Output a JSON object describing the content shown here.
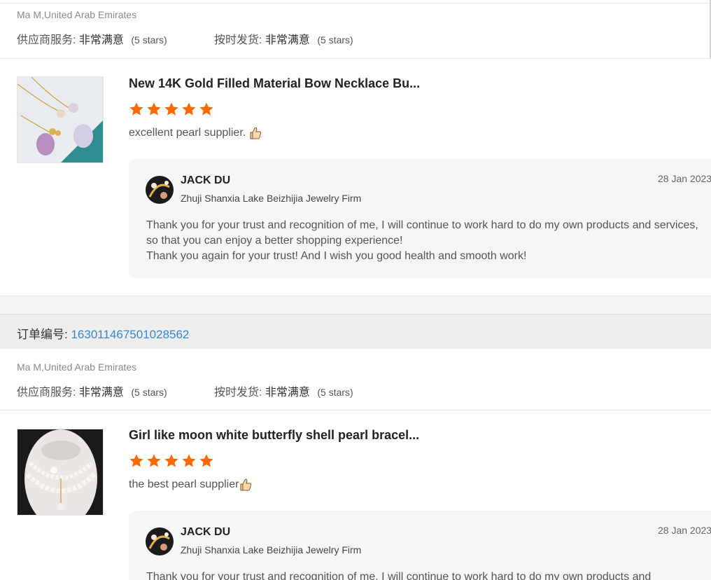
{
  "reviews": [
    {
      "buyer": "Ma M,United Arab Emirates",
      "supplier_service_label": "供应商服务:",
      "supplier_service_value": "非常满意",
      "supplier_service_stars": "(5 stars)",
      "shipping_label": "按时发货:",
      "shipping_value": "非常满意",
      "shipping_stars": "(5 stars)",
      "product": {
        "title": "New 14K Gold Filled Material Bow Necklace Bu...",
        "stars": 5,
        "comment": "excellent pearl supplier.",
        "comment_icon": "thumbs-up-icon"
      },
      "reply": {
        "name": "JACK DU",
        "company": "Zhuji Shanxia Lake Beizhijia Jewelry Firm",
        "date": "28 Jan 2023",
        "text_line1": "Thank you for your trust and recognition of me, I will continue to work hard to do my own products and services, so that you can enjoy a better shopping experience!",
        "text_line2": "Thank you again for your trust! And I wish you good health and smooth work!"
      }
    },
    {
      "order_label": "订单编号:",
      "order_number": "163011467501028562",
      "buyer": "Ma M,United Arab Emirates",
      "supplier_service_label": "供应商服务:",
      "supplier_service_value": "非常满意",
      "supplier_service_stars": "(5 stars)",
      "shipping_label": "按时发货:",
      "shipping_value": "非常满意",
      "shipping_stars": "(5 stars)",
      "product": {
        "title": "Girl like moon white butterfly shell pearl bracel...",
        "stars": 5,
        "comment": "the best pearl supplier",
        "comment_icon": "thumbs-up-icon"
      },
      "reply": {
        "name": "JACK DU",
        "company": "Zhuji Shanxia Lake Beizhijia Jewelry Firm",
        "date": "28 Jan 2023",
        "text_line1": "Thank you for your trust and recognition of me, I will continue to work hard to do my own products and"
      }
    }
  ],
  "colors": {
    "star": "#ff6a00",
    "link": "#3a87c8",
    "reply_bg": "#f5f6f8",
    "order_bar_bg": "#ededed"
  }
}
